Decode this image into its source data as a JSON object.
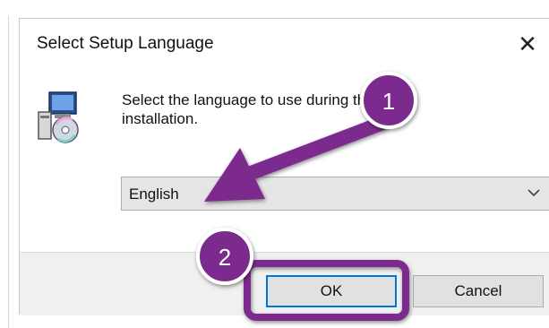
{
  "dialog": {
    "title": "Select Setup Language",
    "close_glyph": "✕",
    "prompt": "Select the language to use during the installation.",
    "icon": "setup-installer-icon"
  },
  "language_select": {
    "selected": "English",
    "chevron_icon": "chevron-down-icon"
  },
  "buttons": {
    "ok_label": "OK",
    "cancel_label": "Cancel"
  },
  "annotations": {
    "step1": "1",
    "step2": "2",
    "accent_color": "#7b2a8d",
    "focus_color": "#0078d7"
  }
}
